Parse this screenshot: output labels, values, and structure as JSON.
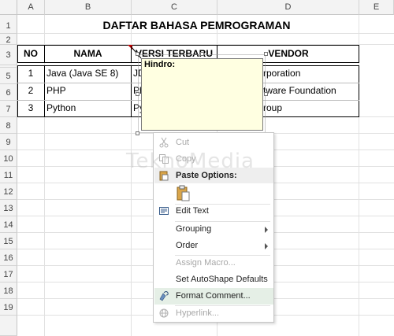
{
  "columns": [
    "A",
    "B",
    "C",
    "D",
    "E"
  ],
  "rows": [
    "1",
    "2",
    "3",
    "4",
    "5",
    "6",
    "7",
    "8",
    "9",
    "10",
    "11",
    "12",
    "13",
    "14",
    "15",
    "16",
    "17",
    "18",
    "19"
  ],
  "table": {
    "title": "DAFTAR BAHASA PEMROGRAMAN",
    "headers": {
      "no": "NO",
      "nama": "NAMA",
      "versi": "VERSI TERBARU",
      "vendor": "VENDOR"
    },
    "data_rows": [
      {
        "no": "1",
        "nama": "Java (Java SE 8)",
        "versi": "JD",
        "vendor": "rporation"
      },
      {
        "no": "2",
        "nama": "PHP",
        "versi": "Ph",
        "vendor": "tware Foundation"
      },
      {
        "no": "3",
        "nama": "Python",
        "versi": "Py",
        "vendor": "roup"
      }
    ]
  },
  "comment": {
    "author": "Hindro:"
  },
  "context_menu": {
    "cut": "Cut",
    "copy": "Copy",
    "paste_options": "Paste Options:",
    "edit_text": "Edit Text",
    "grouping": "Grouping",
    "order": "Order",
    "assign_macro": "Assign Macro...",
    "set_autoshape_defaults": "Set AutoShape Defaults",
    "format_comment": "Format Comment...",
    "hyperlink": "Hyperlink..."
  },
  "watermark": "TeknoMedia",
  "colors": {
    "comment_bg": "#ffffe1",
    "menu_hover": "#e5efe6",
    "header_bg": "#f3f3f3"
  }
}
